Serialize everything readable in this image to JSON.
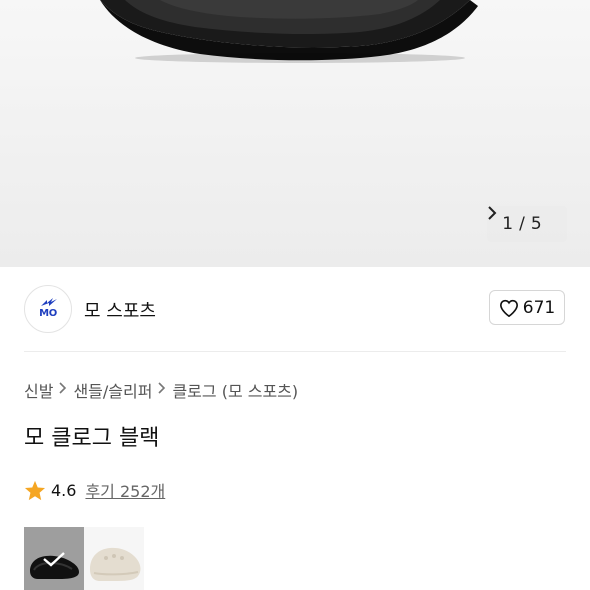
{
  "gallery": {
    "current": "1",
    "separator": "/",
    "total": "5",
    "next_icon": "chevron-right-icon"
  },
  "seller": {
    "logo_text": "MO",
    "name": "모 스포츠",
    "like_count": "671"
  },
  "breadcrumb": [
    "신발",
    "샌들/슬리퍼",
    "클로그 (모 스포츠)"
  ],
  "product": {
    "title": "모 클로그 블랙",
    "rating": "4.6",
    "reviews_label": "후기 252개"
  },
  "colors": {
    "star": "#f5a623",
    "logo_blue": "#1f3fbf"
  },
  "thumbnails": [
    {
      "variant": "black",
      "selected": true
    },
    {
      "variant": "cream",
      "selected": false
    }
  ]
}
